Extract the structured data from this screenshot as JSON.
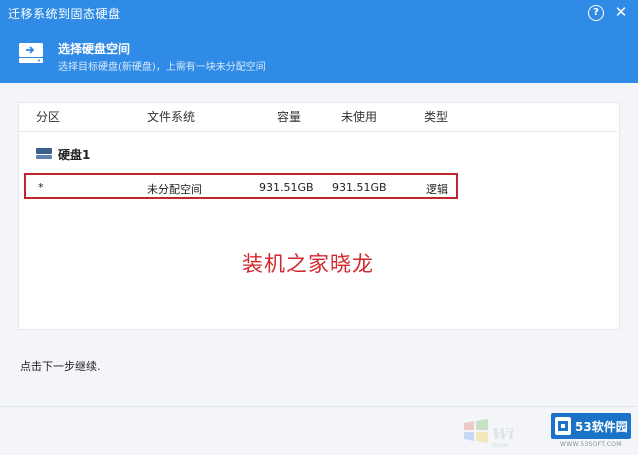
{
  "window": {
    "title": "迁移系统到固态硬盘",
    "help_label": "?",
    "close_label": "✕"
  },
  "header": {
    "title": "选择硬盘空间",
    "subtitle": "选择目标硬盘(新硬盘)，上需有一块未分配空间",
    "icon": "disk-arrow-icon"
  },
  "table": {
    "columns": [
      "分区",
      "文件系统",
      "容量",
      "未使用",
      "类型"
    ],
    "disks": [
      {
        "label": "硬盘1",
        "partitions": [
          {
            "partition": "*",
            "filesystem": "未分配空间",
            "capacity": "931.51GB",
            "unused": "931.51GB",
            "type": "逻辑"
          }
        ]
      }
    ]
  },
  "watermark_text": "装机之家晓龙",
  "hint": "点击下一步继续.",
  "branding": {
    "badge_text": "53软件园",
    "badge_url": "WWW.53SOFT.COM",
    "wm_letters": "Wi",
    "wm_url": "Www."
  },
  "colors": {
    "titlebar": "#2f8be6",
    "selection_border": "#c0272d",
    "watermark": "#d2272d"
  }
}
